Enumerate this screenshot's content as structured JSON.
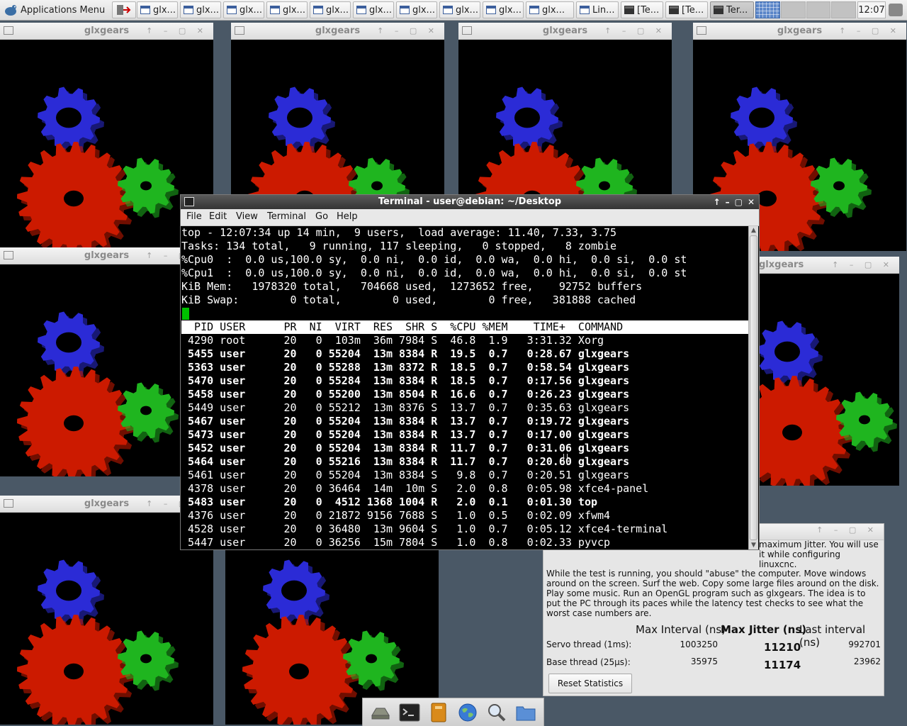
{
  "top_panel": {
    "applications_menu": "Applications Menu",
    "tasks": [
      {
        "label": "glx...",
        "icon": "window-icon"
      },
      {
        "label": "glx...",
        "icon": "window-icon"
      },
      {
        "label": "glx...",
        "icon": "window-icon"
      },
      {
        "label": "glx...",
        "icon": "window-icon"
      },
      {
        "label": "glx...",
        "icon": "window-icon"
      },
      {
        "label": "glx...",
        "icon": "window-icon"
      },
      {
        "label": "glx...",
        "icon": "window-icon"
      },
      {
        "label": "glx...",
        "icon": "window-icon"
      },
      {
        "label": "glx...",
        "icon": "window-icon"
      },
      {
        "label": "glx...",
        "icon": "window-icon"
      },
      {
        "label": "Lin...",
        "icon": "window-icon"
      },
      {
        "label": "[Te...",
        "icon": "terminal-icon"
      },
      {
        "label": "[Te...",
        "icon": "terminal-icon"
      },
      {
        "label": "Ter...",
        "icon": "terminal-icon"
      }
    ],
    "clock": "12:07"
  },
  "glxgears_title": "glxgears",
  "gear_colors": {
    "red": "#cc1a00",
    "green": "#1fb51f",
    "blue": "#2b2bd6"
  },
  "terminal": {
    "title": "Terminal - user@debian: ~/Desktop",
    "menu": [
      "File",
      "Edit",
      "View",
      "Terminal",
      "Go",
      "Help"
    ],
    "summary": [
      "top - 12:07:34 up 14 min,  9 users,  load average: 11.40, 7.33, 3.75",
      "Tasks: 134 total,   9 running, 117 sleeping,   0 stopped,   8 zombie",
      "%Cpu0  :  0.0 us,100.0 sy,  0.0 ni,  0.0 id,  0.0 wa,  0.0 hi,  0.0 si,  0.0 st",
      "%Cpu1  :  0.0 us,100.0 sy,  0.0 ni,  0.0 id,  0.0 wa,  0.0 hi,  0.0 si,  0.0 st",
      "KiB Mem:   1978320 total,   704668 used,  1273652 free,    92752 buffers",
      "KiB Swap:        0 total,        0 used,        0 free,   381888 cached"
    ],
    "header": "  PID USER      PR  NI  VIRT  RES  SHR S  %CPU %MEM    TIME+  COMMAND",
    "processes": [
      {
        "pid": "4290",
        "user": "root",
        "pr": "20",
        "ni": "0",
        "virt": "103m",
        "res": "36m",
        "shr": "7984",
        "s": "S",
        "cpu": "46.8",
        "mem": "1.9",
        "time": "3:31.32",
        "cmd": "Xorg",
        "bold": false
      },
      {
        "pid": "5455",
        "user": "user",
        "pr": "20",
        "ni": "0",
        "virt": "55204",
        "res": "13m",
        "shr": "8384",
        "s": "R",
        "cpu": "19.5",
        "mem": "0.7",
        "time": "0:28.67",
        "cmd": "glxgears",
        "bold": true
      },
      {
        "pid": "5363",
        "user": "user",
        "pr": "20",
        "ni": "0",
        "virt": "55288",
        "res": "13m",
        "shr": "8372",
        "s": "R",
        "cpu": "18.5",
        "mem": "0.7",
        "time": "0:58.54",
        "cmd": "glxgears",
        "bold": true
      },
      {
        "pid": "5470",
        "user": "user",
        "pr": "20",
        "ni": "0",
        "virt": "55284",
        "res": "13m",
        "shr": "8384",
        "s": "R",
        "cpu": "18.5",
        "mem": "0.7",
        "time": "0:17.56",
        "cmd": "glxgears",
        "bold": true
      },
      {
        "pid": "5458",
        "user": "user",
        "pr": "20",
        "ni": "0",
        "virt": "55200",
        "res": "13m",
        "shr": "8504",
        "s": "R",
        "cpu": "16.6",
        "mem": "0.7",
        "time": "0:26.23",
        "cmd": "glxgears",
        "bold": true
      },
      {
        "pid": "5449",
        "user": "user",
        "pr": "20",
        "ni": "0",
        "virt": "55212",
        "res": "13m",
        "shr": "8376",
        "s": "S",
        "cpu": "13.7",
        "mem": "0.7",
        "time": "0:35.63",
        "cmd": "glxgears",
        "bold": false
      },
      {
        "pid": "5467",
        "user": "user",
        "pr": "20",
        "ni": "0",
        "virt": "55204",
        "res": "13m",
        "shr": "8384",
        "s": "R",
        "cpu": "13.7",
        "mem": "0.7",
        "time": "0:19.72",
        "cmd": "glxgears",
        "bold": true
      },
      {
        "pid": "5473",
        "user": "user",
        "pr": "20",
        "ni": "0",
        "virt": "55204",
        "res": "13m",
        "shr": "8384",
        "s": "R",
        "cpu": "13.7",
        "mem": "0.7",
        "time": "0:17.00",
        "cmd": "glxgears",
        "bold": true
      },
      {
        "pid": "5452",
        "user": "user",
        "pr": "20",
        "ni": "0",
        "virt": "55204",
        "res": "13m",
        "shr": "8384",
        "s": "R",
        "cpu": "11.7",
        "mem": "0.7",
        "time": "0:31.06",
        "cmd": "glxgears",
        "bold": true
      },
      {
        "pid": "5464",
        "user": "user",
        "pr": "20",
        "ni": "0",
        "virt": "55216",
        "res": "13m",
        "shr": "8384",
        "s": "R",
        "cpu": "11.7",
        "mem": "0.7",
        "time": "0:20.60",
        "cmd": "glxgears",
        "bold": true
      },
      {
        "pid": "5461",
        "user": "user",
        "pr": "20",
        "ni": "0",
        "virt": "55204",
        "res": "13m",
        "shr": "8384",
        "s": "S",
        "cpu": "9.8",
        "mem": "0.7",
        "time": "0:20.51",
        "cmd": "glxgears",
        "bold": false
      },
      {
        "pid": "4378",
        "user": "user",
        "pr": "20",
        "ni": "0",
        "virt": "36464",
        "res": "14m",
        "shr": "10m",
        "s": "S",
        "cpu": "2.0",
        "mem": "0.8",
        "time": "0:05.98",
        "cmd": "xfce4-panel",
        "bold": false
      },
      {
        "pid": "5483",
        "user": "user",
        "pr": "20",
        "ni": "0",
        "virt": "4512",
        "res": "1368",
        "shr": "1004",
        "s": "R",
        "cpu": "2.0",
        "mem": "0.1",
        "time": "0:01.30",
        "cmd": "top",
        "bold": true
      },
      {
        "pid": "4376",
        "user": "user",
        "pr": "20",
        "ni": "0",
        "virt": "21872",
        "res": "9156",
        "shr": "7688",
        "s": "S",
        "cpu": "1.0",
        "mem": "0.5",
        "time": "0:02.09",
        "cmd": "xfwm4",
        "bold": false
      },
      {
        "pid": "4528",
        "user": "user",
        "pr": "20",
        "ni": "0",
        "virt": "36480",
        "res": "13m",
        "shr": "9604",
        "s": "S",
        "cpu": "1.0",
        "mem": "0.7",
        "time": "0:05.12",
        "cmd": "xfce4-terminal",
        "bold": false
      },
      {
        "pid": "5447",
        "user": "user",
        "pr": "20",
        "ni": "0",
        "virt": "36256",
        "res": "15m",
        "shr": "7804",
        "s": "S",
        "cpu": "1.0",
        "mem": "0.8",
        "time": "0:02.33",
        "cmd": "pyvcp",
        "bold": false
      }
    ]
  },
  "latency": {
    "intro": "maximum Jitter.  You will use it while configuring linuxcnc.",
    "paragraph": "While the test is running, you should \"abuse\" the computer. Move windows around on the screen. Surf the web. Copy some large files around on the disk. Play some music. Run an OpenGL program such as glxgears. The idea is to put the PC through its paces while the latency test checks to see what the worst case numbers are.",
    "col_max_interval": "Max Interval (ns)",
    "col_max_jitter": "Max Jitter (ns)",
    "col_last_interval": "Last interval (ns)",
    "servo_label": "Servo thread (1ms):",
    "servo_max_interval": "1003250",
    "servo_max_jitter": "11210",
    "servo_last_interval": "992701",
    "base_label": "Base thread (25µs):",
    "base_max_interval": "35975",
    "base_max_jitter": "11174",
    "base_last_interval": "23962",
    "reset_button": "Reset Statistics"
  },
  "dock": {
    "icons": [
      "drive-icon",
      "terminal-icon",
      "file-manager-icon",
      "web-browser-icon",
      "search-icon",
      "folder-icon"
    ]
  }
}
